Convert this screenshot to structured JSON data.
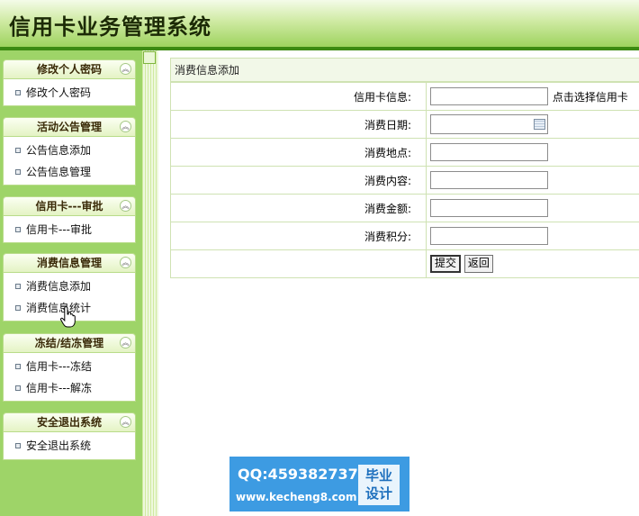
{
  "header": {
    "title": "信用卡业务管理系统"
  },
  "sidebar": {
    "groups": [
      {
        "title": "修改个人密码",
        "items": [
          "修改个人密码"
        ]
      },
      {
        "title": "活动公告管理",
        "items": [
          "公告信息添加",
          "公告信息管理"
        ]
      },
      {
        "title": "信用卡---审批",
        "items": [
          "信用卡---审批"
        ]
      },
      {
        "title": "消费信息管理",
        "items": [
          "消费信息添加",
          "消费信息统计"
        ]
      },
      {
        "title": "冻结/结冻管理",
        "items": [
          "信用卡---冻结",
          "信用卡---解冻"
        ]
      },
      {
        "title": "安全退出系统",
        "items": [
          "安全退出系统"
        ]
      }
    ],
    "collapse_glyph": "︽"
  },
  "main": {
    "panel_title": "消费信息添加",
    "fields": {
      "card": {
        "label": "信用卡信息:",
        "value": "",
        "pick_link": "点击选择信用卡"
      },
      "date": {
        "label": "消费日期:",
        "value": ""
      },
      "place": {
        "label": "消费地点:",
        "value": ""
      },
      "content": {
        "label": "消费内容:",
        "value": ""
      },
      "amount": {
        "label": "消费金额:",
        "value": ""
      },
      "points": {
        "label": "消费积分:",
        "value": ""
      }
    },
    "buttons": {
      "submit": "提交",
      "back": "返回"
    }
  },
  "watermark": {
    "qq": "QQ:459382737",
    "url": "www.kecheng8.com",
    "badge_line1": "毕业",
    "badge_line2": "设计"
  },
  "colors": {
    "header_green": "#9ed35e",
    "header_line": "#3c8a12",
    "sidebar_bg": "#9ed468",
    "border": "#cfe2b3",
    "watermark_blue": "#3d9be2"
  }
}
